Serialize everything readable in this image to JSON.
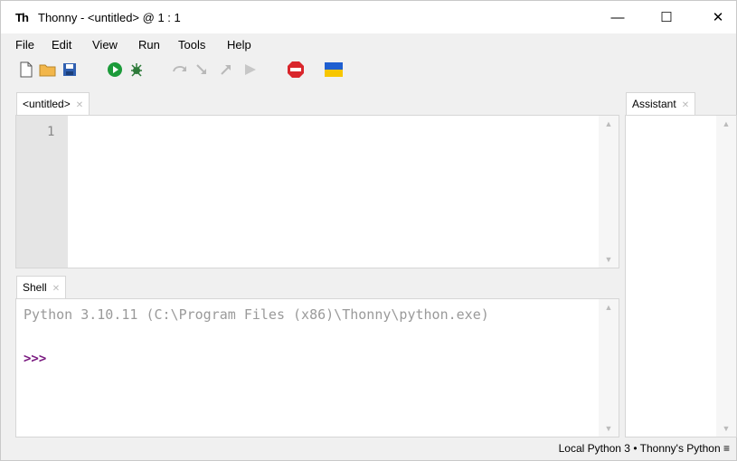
{
  "window": {
    "app_icon": "Th",
    "title": "Thonny - <untitled> @ 1 : 1",
    "minimize": "—",
    "maximize": "☐",
    "close": "✕"
  },
  "menu": [
    "File",
    "Edit",
    "View",
    "Run",
    "Tools",
    "Help"
  ],
  "toolbar": {
    "icons": [
      "new-file-icon",
      "open-folder-icon",
      "save-icon",
      "run-icon",
      "debug-icon",
      "step-over-icon",
      "step-into-icon",
      "step-out-icon",
      "resume-icon",
      "stop-icon",
      "ukraine-flag-icon"
    ]
  },
  "editor": {
    "tab_label": "<untitled>",
    "line_number": "1"
  },
  "shell": {
    "tab_label": "Shell",
    "output": "Python 3.10.11 (C:\\Program Files (x86)\\Thonny\\python.exe)",
    "prompt": ">>>"
  },
  "assistant": {
    "tab_label": "Assistant"
  },
  "status": {
    "text": "Local Python 3  •  Thonny's Python"
  },
  "colors": {
    "run_green": "#1c9b3a",
    "stop_red": "#d9262c",
    "prompt_purple": "#7a1a80",
    "flag_blue": "#1f5fd0",
    "flag_yellow": "#f7c600"
  }
}
